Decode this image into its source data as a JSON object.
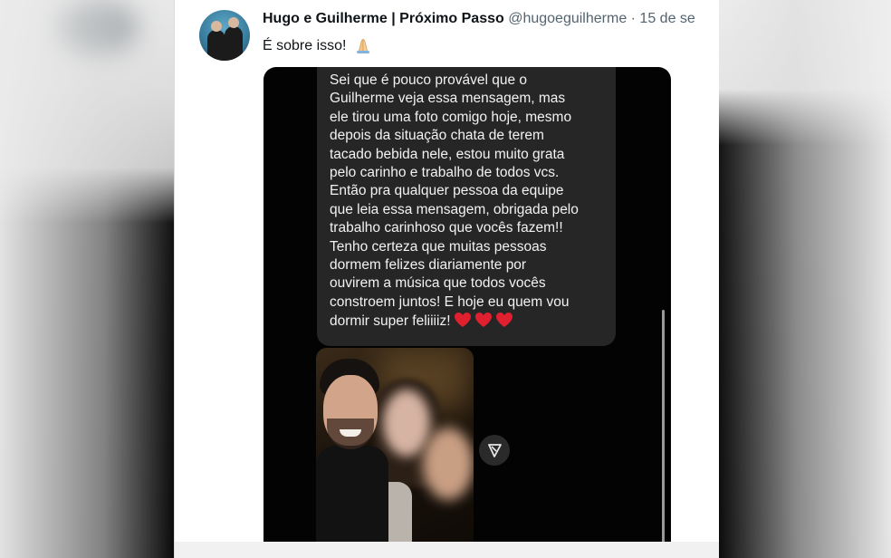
{
  "tweet": {
    "author_name": "Hugo e Guilherme | Próximo Passo",
    "handle": "@hugoeguilherme · 15 de se",
    "text": "É sobre isso!"
  },
  "media": {
    "message_lines": [
      "Sei que é pouco provável que o",
      "Guilherme veja essa mensagem, mas",
      "ele tirou uma foto comigo hoje, mesmo",
      "depois da situação chata de terem",
      "tacado bebida nele, estou muito grata",
      "pelo carinho e trabalho de todos vcs.",
      "Então pra qualquer pessoa da equipe",
      "que leia essa mensagem, obrigada pelo",
      "trabalho carinhoso que vocês fazem!!",
      "Tenho certeza que muitas pessoas",
      "dormem felizes diariamente por",
      "ouvirem a música que todos vocês",
      "constroem juntos! E hoje eu quem vou",
      "dormir super feliiiiz!"
    ]
  },
  "colors": {
    "name": "#0f1419",
    "secondary": "#536471",
    "bubble": "#262626",
    "heart": "#e0202e"
  },
  "icons": [
    "folded-hands-emoji-icon",
    "red-heart-emoji-icon",
    "forward-share-icon"
  ]
}
